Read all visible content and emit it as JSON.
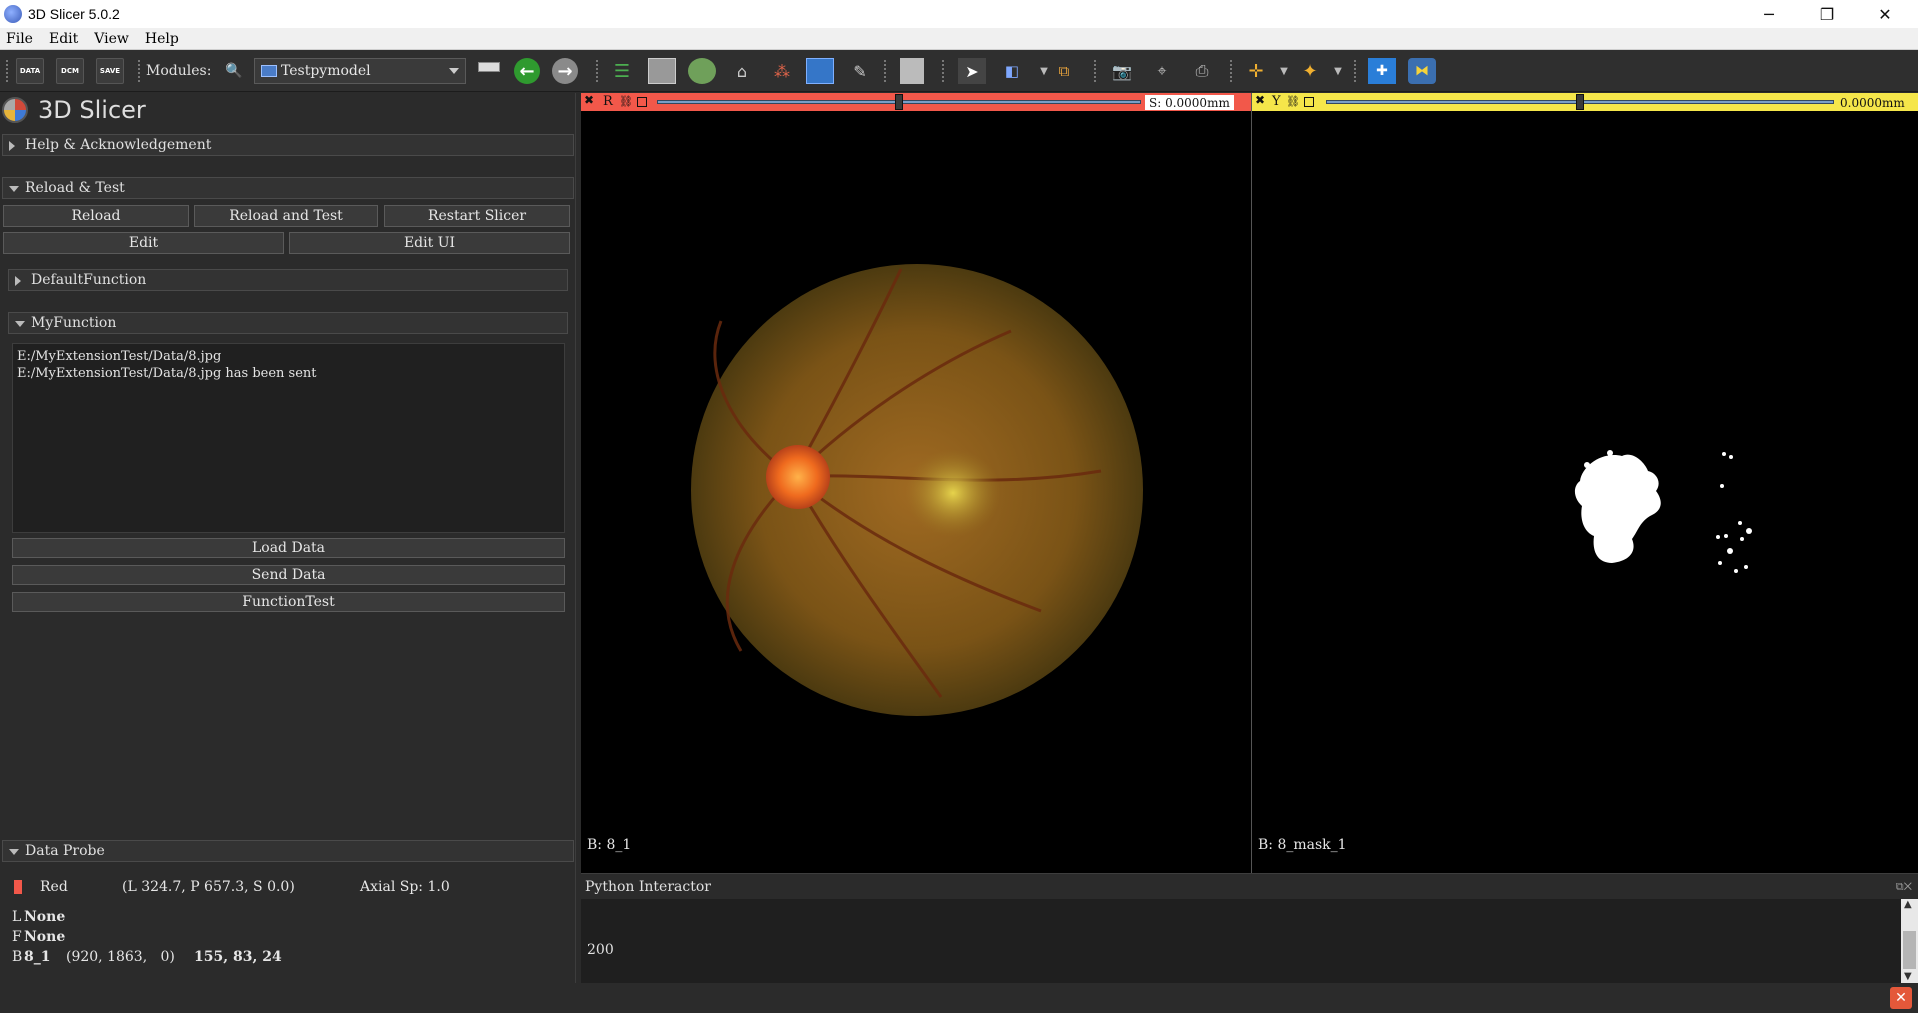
{
  "window": {
    "title": "3D Slicer 5.0.2",
    "minimize": "─",
    "restore": "❐",
    "close": "✕"
  },
  "menubar": {
    "items": [
      "File",
      "Edit",
      "View",
      "Help"
    ]
  },
  "toolbar": {
    "data_label": "DATA",
    "dcm_label": "DCM",
    "save_label": "SAVE",
    "modules_label": "Modules:",
    "module_selected": "Testpymodel"
  },
  "brand": {
    "name": "3D Slicer"
  },
  "sections": {
    "help": "Help & Acknowledgement",
    "reload_test": "Reload & Test",
    "default_function": "DefaultFunction",
    "my_function": "MyFunction",
    "data_probe": "Data Probe"
  },
  "reload_buttons": {
    "reload": "Reload",
    "reload_and_test": "Reload and Test",
    "restart": "Restart Slicer",
    "edit": "Edit",
    "edit_ui": "Edit UI"
  },
  "log": {
    "line1": "E:/MyExtensionTest/Data/8.jpg",
    "line2": "E:/MyExtensionTest/Data/8.jpg has been sent"
  },
  "function_buttons": {
    "load": "Load Data",
    "send": "Send Data",
    "test": "FunctionTest"
  },
  "data_probe": {
    "view_name": "Red",
    "coords": "(L 324.7, P 657.3, S 0.0)",
    "axial": "Axial Sp: 1.0",
    "l_prefix": "L",
    "l_value": "None",
    "f_prefix": "F",
    "f_value": "None",
    "b_prefix": "B",
    "b_name": "8_1",
    "b_ijk": "(920, 1863,   0)",
    "b_value": "155, 83, 24"
  },
  "views": {
    "red": {
      "letter": "R",
      "offset": "S: 0.0000mm",
      "background": "B: 8_1",
      "slider_fraction": 0.5
    },
    "yellow": {
      "letter": "Y",
      "offset": "0.0000mm",
      "background": "B: 8_mask_1",
      "slider_fraction": 0.5
    }
  },
  "python": {
    "title": "Python Interactor",
    "output": "200"
  },
  "colors": {
    "red_view": "#f2584a",
    "yellow_view": "#f5e64a",
    "panel_bg": "#2b2b2b"
  }
}
